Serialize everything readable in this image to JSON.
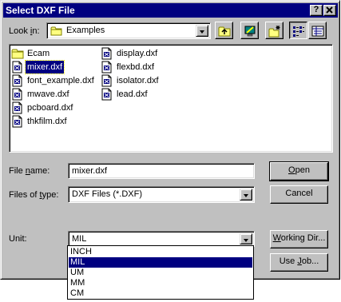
{
  "window": {
    "title": "Select DXF File",
    "help_glyph": "?",
    "close_glyph": "✕"
  },
  "look_in": {
    "label_pre": "Look ",
    "label_key": "i",
    "label_post": "n:",
    "value": "Examples",
    "icon": "folder-icon"
  },
  "toolbar": {
    "up_icon": "up-folder-icon",
    "desktop_icon": "desktop-icon",
    "new_folder_icon": "new-folder-icon",
    "list_view_icon": "list-view-icon",
    "details_view_icon": "details-view-icon"
  },
  "files": {
    "col1": [
      {
        "name": "Ecam",
        "type": "folder"
      },
      {
        "name": "mixer.dxf",
        "type": "file"
      },
      {
        "name": "font_example.dxf",
        "type": "file"
      },
      {
        "name": "mwave.dxf",
        "type": "file"
      },
      {
        "name": "pcboard.dxf",
        "type": "file"
      },
      {
        "name": "thkfilm.dxf",
        "type": "file"
      }
    ],
    "col2": [
      {
        "name": "display.dxf",
        "type": "file"
      },
      {
        "name": "flexbd.dxf",
        "type": "file"
      },
      {
        "name": "isolator.dxf",
        "type": "file"
      },
      {
        "name": "lead.dxf",
        "type": "file"
      }
    ],
    "selected": "mixer.dxf"
  },
  "file_name": {
    "label_pre": "File ",
    "label_key": "n",
    "label_post": "ame:",
    "value": "mixer.dxf"
  },
  "file_type": {
    "label_pre": "Files of ",
    "label_key": "t",
    "label_post": "ype:",
    "value": "DXF Files (*.DXF)"
  },
  "unit": {
    "label": "Unit:",
    "value": "MIL",
    "options": [
      "INCH",
      "MIL",
      "UM",
      "MM",
      "CM"
    ],
    "selected_index": 1
  },
  "buttons": {
    "open_key": "O",
    "open_rest": "pen",
    "cancel": "Cancel",
    "working_dir_key": "W",
    "working_dir_rest": "orking Dir...",
    "use_job_pre": "Use ",
    "use_job_key": "J",
    "use_job_post": "ob..."
  }
}
